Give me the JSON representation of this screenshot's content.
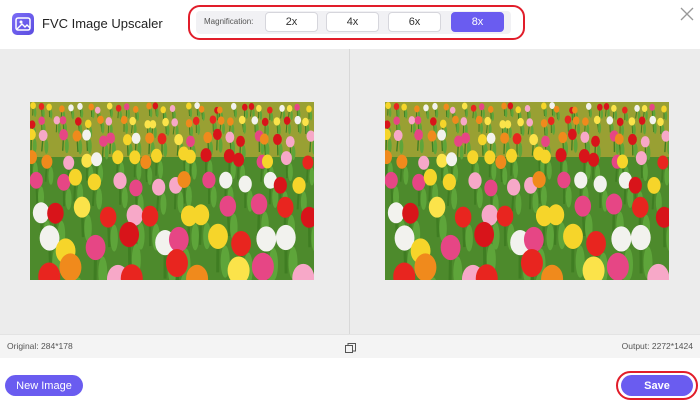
{
  "app": {
    "title": "FVC Image Upscaler",
    "logo_icon": "image-icon"
  },
  "magnification": {
    "label": "Magnification:",
    "options": [
      "2x",
      "4x",
      "6x",
      "8x"
    ],
    "selected": "8x"
  },
  "info": {
    "original": "Original: 284*178",
    "output": "Output: 2272*1424"
  },
  "footer": {
    "new_image_label": "New Image",
    "save_label": "Save"
  },
  "colors": {
    "accent": "#6a5cf0",
    "highlight": "#e11d2a"
  }
}
